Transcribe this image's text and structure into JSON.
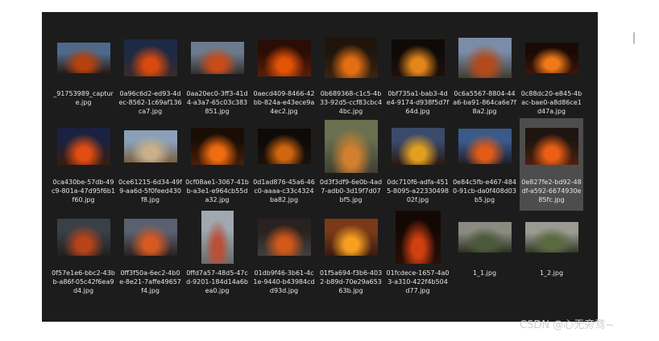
{
  "files": [
    {
      "name": "_91753989_capture.jpg",
      "selected": false,
      "colors": [
        "#4d6a8c",
        "#b7410e",
        "#2a1a12"
      ]
    },
    {
      "name": "0a96c6d2-ed93-4dec-8562-1c69af136ca7.jpg",
      "selected": false,
      "colors": [
        "#1c2a44",
        "#d9480f",
        "#3a2a2a"
      ]
    },
    {
      "name": "0aa20ec0-3ff3-41d4-a3a7-65c03c383851.jpg",
      "selected": false,
      "colors": [
        "#6b7b8c",
        "#c94a1a",
        "#303030"
      ]
    },
    {
      "name": "0aecd409-8466-42bb-824a-e43ece9a4ec2.jpg",
      "selected": false,
      "colors": [
        "#2a0d05",
        "#e35205",
        "#5a1e08"
      ]
    },
    {
      "name": "0b689368-c1c5-4b33-92d5-ccf83cbc44bc.jpg",
      "selected": false,
      "colors": [
        "#1f150c",
        "#e46f13",
        "#3b2410"
      ]
    },
    {
      "name": "0bf735a1-bab3-4de4-9174-d938f5d7f64d.jpg",
      "selected": false,
      "colors": [
        "#0f0a08",
        "#e3861a",
        "#201008"
      ]
    },
    {
      "name": "0c6a5567-8804-44a6-ba91-864ca6e7f8a2.jpg",
      "selected": false,
      "colors": [
        "#7b8ca8",
        "#b34a1a",
        "#3d3d30"
      ]
    },
    {
      "name": "0c88dc20-e845-4bac-bae0-a8d86ce1d47a.jpg",
      "selected": false,
      "colors": [
        "#1a0a05",
        "#f07a1a",
        "#3d1408"
      ]
    },
    {
      "name": "0ca430be-57db-49c9-801a-47d95f6b1f60.jpg",
      "selected": false,
      "colors": [
        "#1a2240",
        "#e14c12",
        "#3a1c10"
      ]
    },
    {
      "name": "0ce61215-6d34-49f9-aa6d-5f0feed430f8.jpg",
      "selected": false,
      "colors": [
        "#8aa0b8",
        "#c9b08a",
        "#7a6040"
      ]
    },
    {
      "name": "0cf08ae1-3067-41bb-a3e1-e964cb55da32.jpg",
      "selected": false,
      "colors": [
        "#1a0d05",
        "#ef6c10",
        "#4a1e08"
      ]
    },
    {
      "name": "0d1ad876-45a6-46c0-aaaa-c33c4324ba82.jpg",
      "selected": false,
      "colors": [
        "#0d0a08",
        "#d2660d",
        "#1e1208"
      ]
    },
    {
      "name": "0d3f3df9-6e0b-4ad7-adb0-3d19f7d07bf5.jpg",
      "selected": false,
      "colors": [
        "#6a7050",
        "#d28030",
        "#3d4030"
      ]
    },
    {
      "name": "0dc710f6-adfa-4515-8095-a2233049802f.jpg",
      "selected": false,
      "colors": [
        "#3a4a6a",
        "#e3a020",
        "#2a1a10"
      ]
    },
    {
      "name": "0e84c5fb-e467-4840-91cb-da0f408d03b5.jpg",
      "selected": false,
      "colors": [
        "#3a5a8a",
        "#e25a18",
        "#1e1e28"
      ]
    },
    {
      "name": "0e827fe2-bd92-48df-a592-6674930e85fc.jpg",
      "selected": true,
      "colors": [
        "#1e1410",
        "#ea5f15",
        "#4d2010"
      ]
    },
    {
      "name": "0f57e1e6-bbc2-43bb-a86f-05c42f6ea9d4.jpg",
      "selected": false,
      "colors": [
        "#3a4048",
        "#b8431a",
        "#202020"
      ]
    },
    {
      "name": "0ff3f50a-6ec2-4b0e-8e21-7affe49657f4.jpg",
      "selected": false,
      "colors": [
        "#5a6070",
        "#d65a20",
        "#2a2020"
      ]
    },
    {
      "name": "0ffd7a57-48d5-47cd-9201-184d14a6bea0.jpg",
      "selected": false,
      "colors": [
        "#a0a8b0",
        "#b8503a",
        "#6a6a6a"
      ]
    },
    {
      "name": "01db9f46-3b61-4c1e-9440-b43984cdd93d.jpg",
      "selected": false,
      "colors": [
        "#2a2220",
        "#d2581a",
        "#404040"
      ]
    },
    {
      "name": "01f5a694-f3b6-4032-b89d-70e29a65363b.jpg",
      "selected": false,
      "colors": [
        "#7a3a18",
        "#f6a020",
        "#3a1a10"
      ]
    },
    {
      "name": "01fcdece-1657-4a03-a310-422f4b504d77.jpg",
      "selected": false,
      "colors": [
        "#140805",
        "#d04010",
        "#2a0e06"
      ]
    },
    {
      "name": "1_1.jpg",
      "selected": false,
      "colors": [
        "#8a8a80",
        "#4a5a3a",
        "#2a3020"
      ]
    },
    {
      "name": "1_2.jpg",
      "selected": false,
      "colors": [
        "#9a9a90",
        "#5a6a40",
        "#303826"
      ]
    }
  ],
  "watermark": "CSDN @心无旁骛~"
}
